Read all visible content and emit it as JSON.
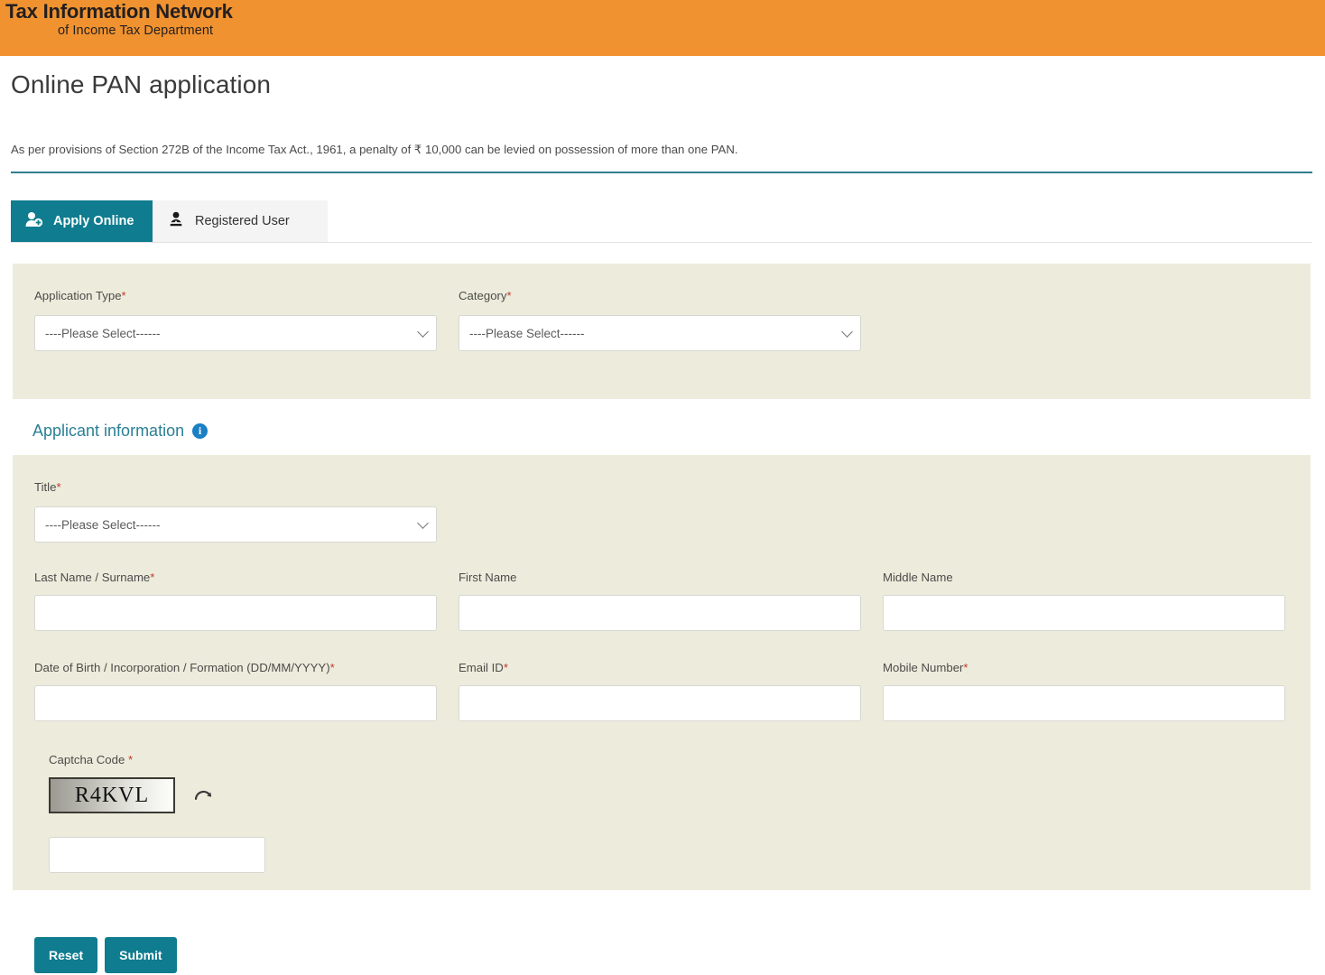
{
  "header": {
    "logo_line1": "Tax Information Network",
    "logo_line2": "of Income Tax Department",
    "band_color": "#f0922f"
  },
  "page": {
    "title": "Online PAN application",
    "disclaimer": "As per provisions of Section 272B of the Income Tax Act., 1961, a penalty of ₹ 10,000 can be levied on possession of more than one PAN.",
    "accent_color": "#0f7c8f",
    "panel_color": "#edecdc"
  },
  "tabs": [
    {
      "label": "Apply Online",
      "icon": "user-add-icon",
      "active": true
    },
    {
      "label": "Registered User",
      "icon": "user-icon",
      "active": false
    }
  ],
  "application_section": {
    "application_type": {
      "label": "Application Type",
      "required": "*",
      "value": "----Please Select------"
    },
    "category": {
      "label": "Category",
      "required": "*",
      "value": "----Please Select------"
    }
  },
  "applicant_section": {
    "heading": "Applicant information",
    "info_icon": "info-icon",
    "info_glyph": "i",
    "title_field": {
      "label": "Title",
      "required": "*",
      "value": "----Please Select------"
    },
    "last_name": {
      "label": "Last Name / Surname",
      "required": "*",
      "value": ""
    },
    "first_name": {
      "label": "First Name",
      "required": "",
      "value": ""
    },
    "middle_name": {
      "label": "Middle Name",
      "required": "",
      "value": ""
    },
    "dob": {
      "label": "Date of Birth / Incorporation / Formation (DD/MM/YYYY)",
      "required": "*",
      "value": ""
    },
    "email": {
      "label": "Email ID",
      "required": "*",
      "value": ""
    },
    "mobile": {
      "label": "Mobile Number",
      "required": "*",
      "value": ""
    },
    "captcha": {
      "label": "Captcha Code ",
      "required": "*",
      "code": "R4KVL",
      "refresh_icon": "refresh-icon",
      "input_value": ""
    }
  },
  "actions": {
    "reset_label": "Reset",
    "submit_label": "Submit"
  }
}
